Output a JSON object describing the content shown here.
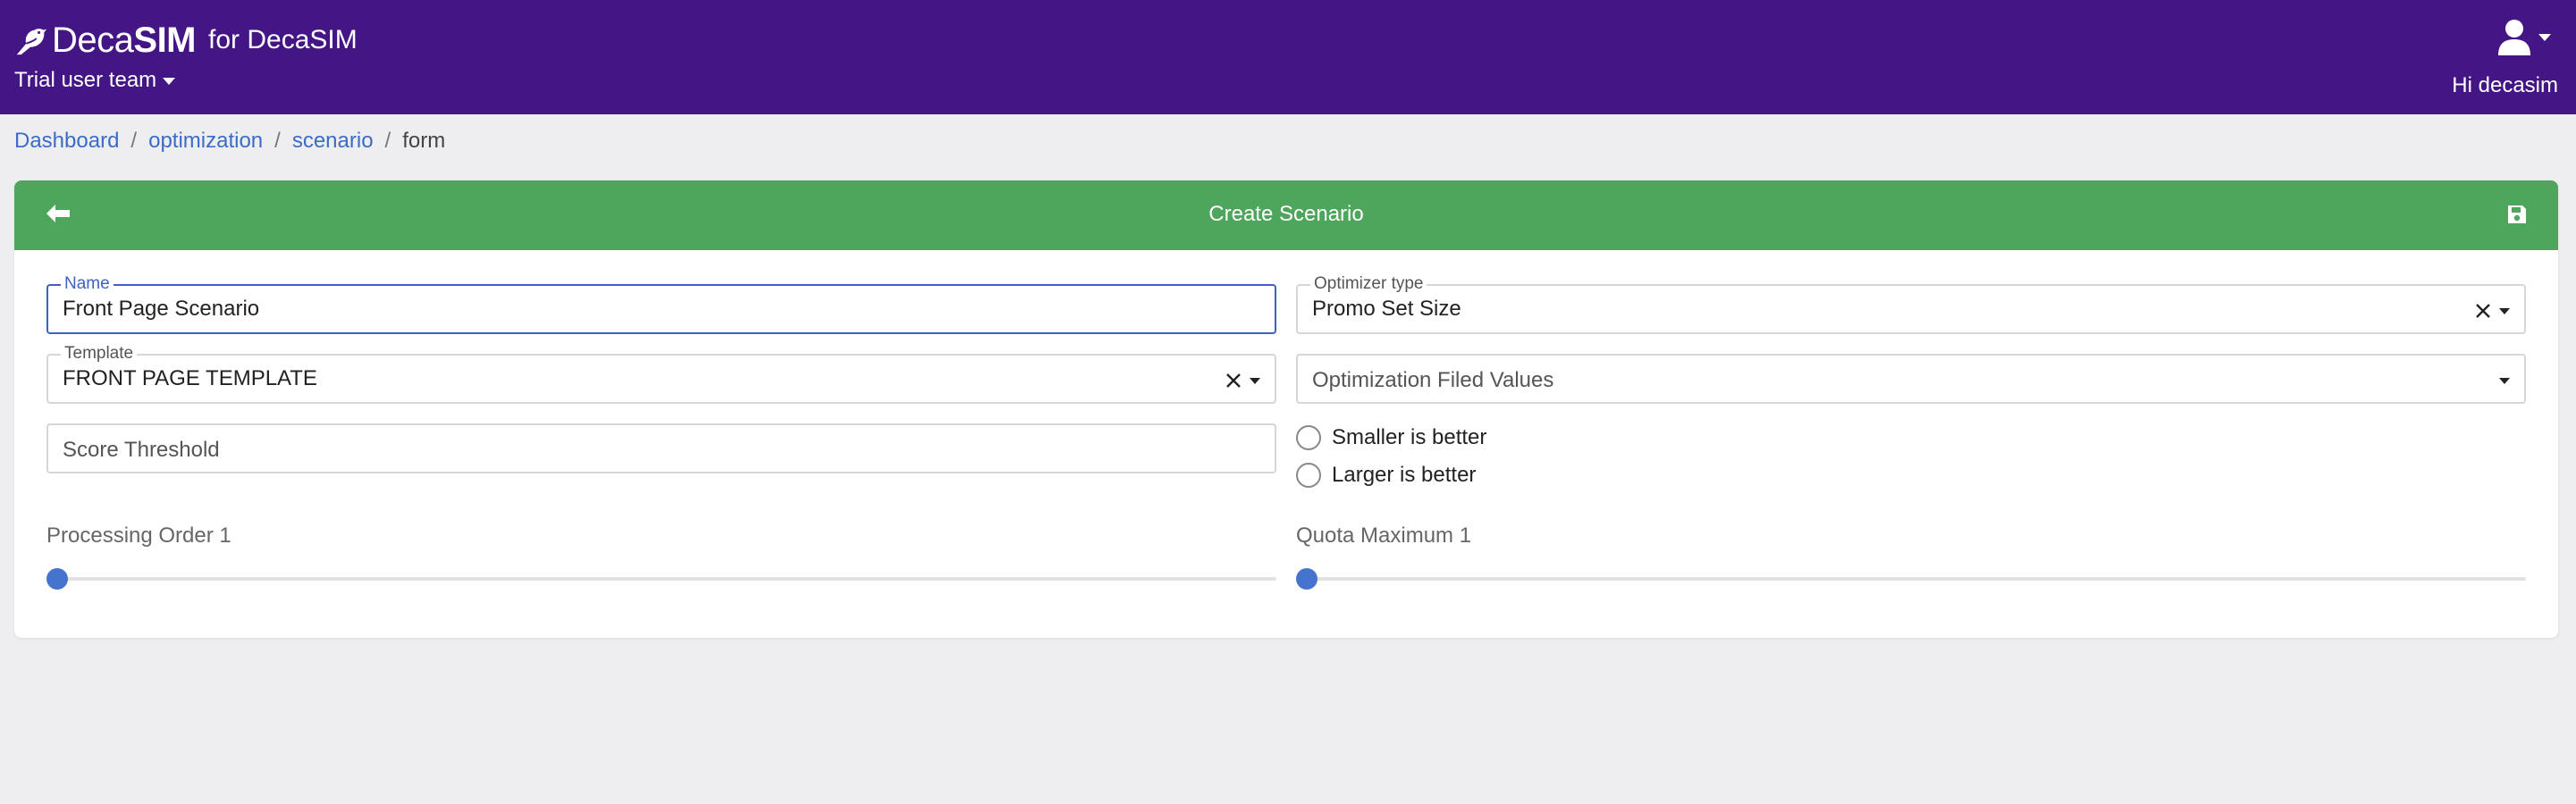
{
  "header": {
    "brand_deca": "Deca",
    "brand_sim": "SIM",
    "brand_suffix": "for DecaSIM",
    "team_label": "Trial user team",
    "greeting": "Hi decasim",
    "user_icon": "user-icon"
  },
  "breadcrumb": {
    "items": [
      "Dashboard",
      "optimization",
      "scenario"
    ],
    "current": "form"
  },
  "card": {
    "title": "Create Scenario",
    "back_icon": "arrow-left-icon",
    "save_icon": "floppy-disk-icon",
    "header_color": "#4ea55c"
  },
  "form": {
    "name": {
      "label": "Name",
      "value": "Front Page Scenario"
    },
    "optimizer_type": {
      "label": "Optimizer type",
      "value": "Promo Set Size"
    },
    "template": {
      "label": "Template",
      "value": "FRONT PAGE TEMPLATE"
    },
    "optimization_filed_values": {
      "placeholder": "Optimization Filed Values"
    },
    "score_threshold": {
      "placeholder": "Score Threshold"
    },
    "radios": [
      {
        "label": "Smaller is better",
        "checked": false
      },
      {
        "label": "Larger is better",
        "checked": false
      }
    ],
    "processing_order": {
      "label": "Processing Order 1",
      "level": 0
    },
    "quota_maximum": {
      "label": "Quota Maximum 1",
      "level": 0
    }
  },
  "colors": {
    "topbar": "#441585",
    "accent": "#3d63c0",
    "link": "#3b6cc7",
    "background": "#eeedf0"
  }
}
